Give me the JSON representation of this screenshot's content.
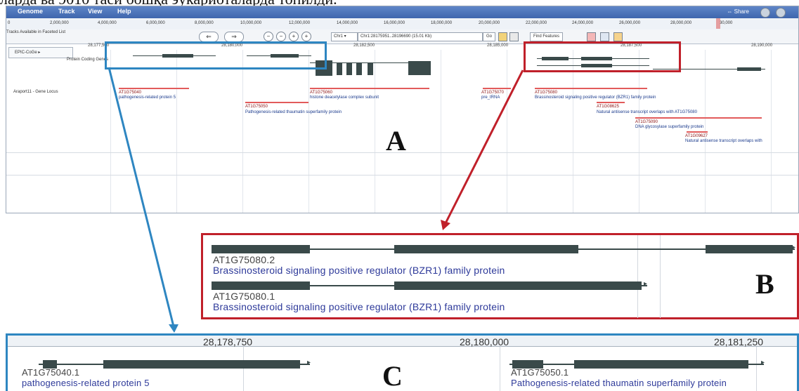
{
  "caption_fragment": "ларда ва 9010 таси бошқа эукариоталарда  топилди.",
  "browser": {
    "menu": [
      "Genome",
      "Track",
      "View",
      "Help"
    ],
    "share": "Share",
    "overview_ticks": [
      "0",
      "2,000,000",
      "4,000,000",
      "6,000,000",
      "8,000,000",
      "10,000,000",
      "12,000,000",
      "14,000,000",
      "16,000,000",
      "18,000,000",
      "20,000,000",
      "22,000,000",
      "24,000,000",
      "26,000,000",
      "28,000,000",
      "30,000"
    ],
    "tracks_hint": "Tracks Available in Faceted List",
    "location": "Chr1:28175951..28196690 (15.01 Kb)",
    "chrom": "Chr1",
    "go": "Go",
    "find_features": "Find Features",
    "ruler": [
      "28,177,500",
      "28,180,000",
      "28,182,500",
      "28,185,000",
      "28,187,500",
      "28,190,000"
    ],
    "epic_label": "EPIC-CoGe",
    "protein_coding_label": "Protein Coding Genes",
    "araport_label": "Araport11 - Gene Locus",
    "features": [
      {
        "id": "AT1G75040",
        "desc": "pathogenesis-related protein 5"
      },
      {
        "id": "AT1G75050",
        "desc": "Pathogenesis-related thaumatin superfamily protein"
      },
      {
        "id": "AT1G75060",
        "desc": "histone deacetylase complex subunit"
      },
      {
        "id": "AT1G75070",
        "desc": "pre_tRNA"
      },
      {
        "id": "AT1G75080",
        "desc": "Brassinosteroid signaling positive regulator (BZR1) family protein"
      },
      {
        "id": "AT1G08625",
        "desc": "Natural antisense transcript overlaps with AT1G75080"
      },
      {
        "id": "AT1G75090",
        "desc": "DNA glycosylase superfamily protein"
      },
      {
        "id": "AT1G09627",
        "desc": "Natural antisense transcript overlaps with"
      }
    ]
  },
  "labels": {
    "a": "A",
    "b": "B",
    "c": "C"
  },
  "panelB": {
    "rows": [
      {
        "id": "AT1G75080.2",
        "desc": "Brassinosteroid signaling positive regulator (BZR1) family protein"
      },
      {
        "id": "AT1G75080.1",
        "desc": "Brassinosteroid signaling positive regulator (BZR1) family protein"
      }
    ]
  },
  "panelC": {
    "ruler": [
      "28,178,750",
      "28,180,000",
      "28,181,250"
    ],
    "genes": [
      {
        "id": "AT1G75040.1",
        "desc": "pathogenesis-related protein 5"
      },
      {
        "id": "AT1G75050.1",
        "desc": "Pathogenesis-related thaumatin superfamily protein"
      }
    ]
  },
  "colors": {
    "highlight_blue": "#2e86c1",
    "highlight_red": "#c0202a",
    "gene_glyph": "#3a4a4a"
  }
}
